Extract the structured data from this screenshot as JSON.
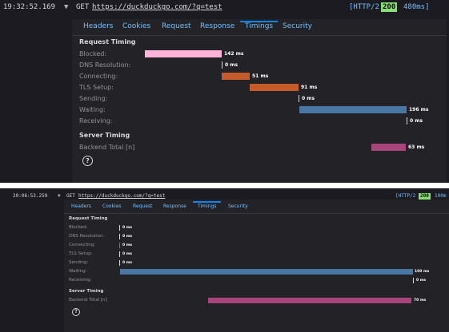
{
  "colors": {
    "blocked": "#ffb3d9",
    "connecting": "#c55a2a",
    "tls": "#c55a2a",
    "waiting": "#4a77a3",
    "server": "#a8457a",
    "status_bg": "#86de74",
    "accent": "#75bfff"
  },
  "requests": [
    {
      "timestamp": "19:32:52.169",
      "method": "GET",
      "url": "https://duckduckgo.com/?q=test",
      "http_version": "[HTTP/2",
      "status": "200",
      "duration": "480ms]",
      "tabs": [
        "Headers",
        "Cookies",
        "Request",
        "Response",
        "Timings",
        "Security"
      ],
      "selected_tab": "Timings",
      "request_timing_title": "Request Timing",
      "timings": [
        {
          "label": "Blocked:",
          "value": "142 ms",
          "ms": 142
        },
        {
          "label": "DNS Resolution:",
          "value": "0 ms",
          "ms": 0
        },
        {
          "label": "Connecting:",
          "value": "51 ms",
          "ms": 51
        },
        {
          "label": "TLS Setup:",
          "value": "91 ms",
          "ms": 91
        },
        {
          "label": "Sending:",
          "value": "0 ms",
          "ms": 0
        },
        {
          "label": "Waiting:",
          "value": "196 ms",
          "ms": 196
        },
        {
          "label": "Receiving:",
          "value": "0 ms",
          "ms": 0
        }
      ],
      "server_timing_title": "Server Timing",
      "server_timings": [
        {
          "label": "Backend Total [n]",
          "value": "63 ms",
          "ms": 63
        }
      ],
      "help_icon": "?"
    },
    {
      "timestamp": "20:06:53.259",
      "method": "GET",
      "url": "https://duckduckgo.com/?q=test",
      "http_version": "[HTTP/2",
      "status": "200",
      "duration": "100m",
      "tabs": [
        "Headers",
        "Cookies",
        "Request",
        "Response",
        "Timings",
        "Security"
      ],
      "selected_tab": "Timings",
      "request_timing_title": "Request Timing",
      "timings": [
        {
          "label": "Blocked:",
          "value": "0 ms",
          "ms": 0
        },
        {
          "label": "DNS Resolution:",
          "value": "0 ms",
          "ms": 0
        },
        {
          "label": "Connecting:",
          "value": "0 ms",
          "ms": 0
        },
        {
          "label": "TLS Setup:",
          "value": "0 ms",
          "ms": 0
        },
        {
          "label": "Sending:",
          "value": "0 ms",
          "ms": 0
        },
        {
          "label": "Waiting:",
          "value": "100 ms",
          "ms": 100
        },
        {
          "label": "Receiving:",
          "value": "0 ms",
          "ms": 0
        }
      ],
      "server_timing_title": "Server Timing",
      "server_timings": [
        {
          "label": "Backend Total [n]",
          "value": "70 ms",
          "ms": 70
        }
      ],
      "help_icon": "?"
    }
  ]
}
